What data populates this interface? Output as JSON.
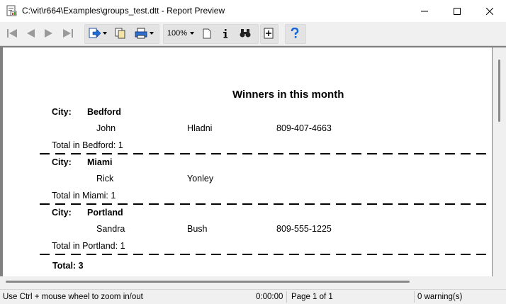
{
  "window": {
    "title": "C:\\vit\\r664\\Examples\\groups_test.dtt - Report Preview"
  },
  "toolbar": {
    "zoom": "100%",
    "buttons": [
      "first-page-icon",
      "prev-page-icon",
      "next-page-icon",
      "last-page-icon",
      "export-icon",
      "copy-icon",
      "print-icon",
      "page-icon",
      "info-icon",
      "find-icon",
      "page-setup-icon",
      "help-icon"
    ]
  },
  "report": {
    "title": "Winners in this month",
    "city_label": "City:",
    "groups": [
      {
        "city": "Bedford",
        "rows": [
          {
            "first": "John",
            "last": "Hladni",
            "phone": "809-407-4663"
          }
        ],
        "total": "Total in Bedford: 1"
      },
      {
        "city": "Miami",
        "rows": [
          {
            "first": "Rick",
            "last": "Yonley",
            "phone": ""
          }
        ],
        "total": "Total in Miami: 1"
      },
      {
        "city": "Portland",
        "rows": [
          {
            "first": "Sandra",
            "last": "Bush",
            "phone": "809-555-1225"
          }
        ],
        "total": "Total in Portland: 1"
      }
    ],
    "grand_total": "Total: 3"
  },
  "status": {
    "hint": "Use Ctrl + mouse wheel to zoom in/out",
    "time": "0:00:00",
    "page": "Page 1 of 1",
    "warnings": "0 warning(s)"
  }
}
